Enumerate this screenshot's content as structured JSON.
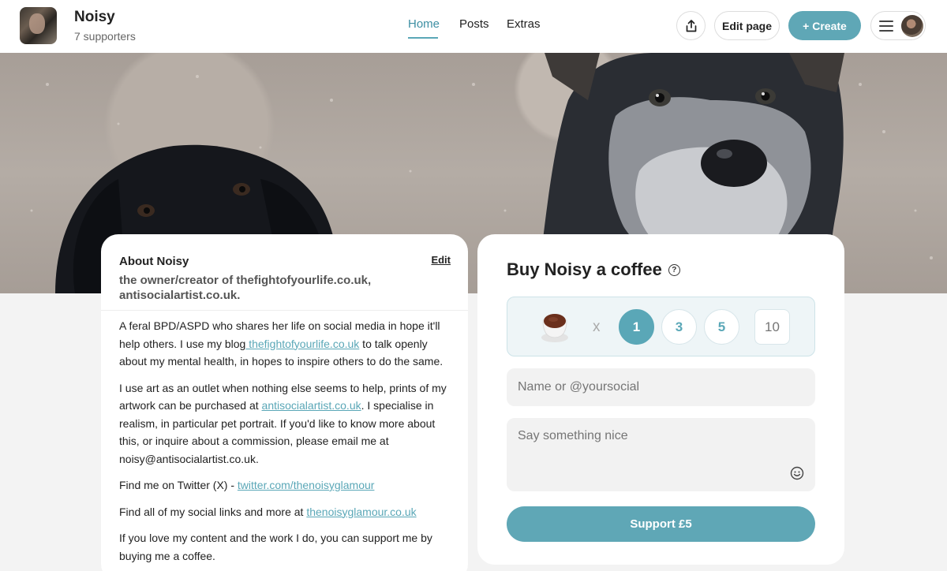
{
  "profile": {
    "name": "Noisy",
    "supporters": "7 supporters"
  },
  "nav": {
    "items": [
      {
        "label": "Home",
        "active": true
      },
      {
        "label": "Posts",
        "active": false
      },
      {
        "label": "Extras",
        "active": false
      }
    ]
  },
  "header_actions": {
    "share_icon": "share-icon",
    "edit_label": "Edit page",
    "create_label": "+ Create",
    "menu_icon": "hamburger-icon"
  },
  "about": {
    "title": "About Noisy",
    "edit_label": "Edit",
    "subtitle": "the owner/creator of thefightofyourlife.co.uk, antisocialartist.co.uk.",
    "bio": {
      "p1_before": "A feral BPD/ASPD who shares her life on social media in hope it'll help others. I use my blog",
      "p1_link": " thefightofyourlife.co.uk",
      "p1_after": " to talk openly about my mental health, in hopes to inspire others to do the same.",
      "p2_before": "I use art as an outlet when nothing else seems to help, prints of my artwork can be purchased at ",
      "p2_link": "antisocialartist.co.uk",
      "p2_after": ". I specialise in realism, in particular pet portrait. If you'd like to know more about this, or inquire about a commission, please email me at noisy@antisocialartist.co.uk.",
      "p3_before": "Find me on Twitter (X) - ",
      "p3_link": "twitter.com/thenoisyglamour",
      "p4_before": "Find all of my social links and more at ",
      "p4_link": "thenoisyglamour.co.uk",
      "p5": "If you love my content and the work I do, you can support me by buying me a coffee."
    }
  },
  "support": {
    "title": "Buy Noisy a coffee",
    "help_icon": "?",
    "times": "x",
    "quantities": [
      "1",
      "3",
      "5"
    ],
    "selected_quantity": "1",
    "custom_placeholder": "10",
    "name_placeholder": "Name or @yoursocial",
    "message_placeholder": "Say something nice",
    "button_label": "Support £5"
  },
  "colors": {
    "accent": "#5fa7b6",
    "link": "#5aa7b7"
  }
}
